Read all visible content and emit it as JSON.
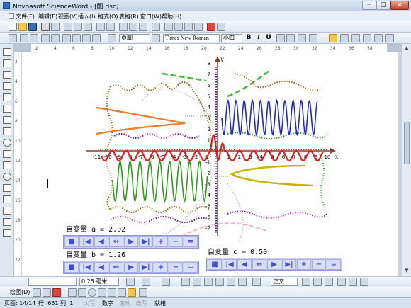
{
  "window": {
    "title": "Novoasoft ScienceWord - [图.dsc]",
    "min_label": "─",
    "max_label": "□",
    "close_label": "×"
  },
  "menu": [
    "文件(F)",
    "编辑(E)",
    "视图(V)",
    "插入(I)",
    "格式(O)",
    "表格(R)",
    "窗口(W)",
    "帮助(H)"
  ],
  "toolbar": {
    "style_value": "页脚",
    "font_value": "Times New Roman",
    "size_value": "小四",
    "bold": "B",
    "italic": "I",
    "underline": "U"
  },
  "ruler": {
    "h_ticks": [
      "2",
      "4",
      "6",
      "8",
      "10",
      "12",
      "14",
      "16",
      "18",
      "20",
      "22",
      "24",
      "26",
      "28",
      "30",
      "32",
      "34",
      "36",
      "38"
    ],
    "v_ticks": [
      "2",
      "4",
      "6",
      "8",
      "10",
      "12",
      "14",
      "16",
      "18",
      "20",
      "22"
    ]
  },
  "graph": {
    "x_label": "x",
    "y_label": "y",
    "y_ticks": [
      "8",
      "7",
      "6",
      "5",
      "4",
      "3",
      "2",
      "1",
      "-1",
      "-2",
      "-3",
      "-4",
      "-5",
      "-6",
      "-7"
    ],
    "x_ticks": [
      "-2",
      "-1",
      "1",
      "2",
      "3",
      "4",
      "5",
      "6",
      "7",
      "8",
      "9",
      "10"
    ],
    "x_ticks_neg": [
      "-11",
      "-10",
      "-9",
      "-8",
      "-7",
      "-6",
      "-5",
      "-4",
      "-3"
    ]
  },
  "variables": {
    "a": {
      "label": "自变量 a = 2.02"
    },
    "b": {
      "label": "自变量 b = 1.26"
    },
    "c": {
      "label": "自变量 c = 0.50"
    }
  },
  "control_buttons": [
    "■",
    "|◀",
    "◀",
    "↔",
    "▶",
    "▶|",
    "+",
    "−",
    "="
  ],
  "drawbar": {
    "line_width": "0.25 毫米",
    "style": "正文",
    "draw_label": "绘图(D)"
  },
  "status": {
    "page": "页面: 14/14",
    "pos": "行: 651 列: 1",
    "caps": "大写",
    "num": "数字",
    "scroll": "滚动",
    "overwrite": "改写",
    "ready": "就绪"
  },
  "colors": {
    "accent": "#3f4ed8",
    "control_bg": "#c5cdf5"
  }
}
